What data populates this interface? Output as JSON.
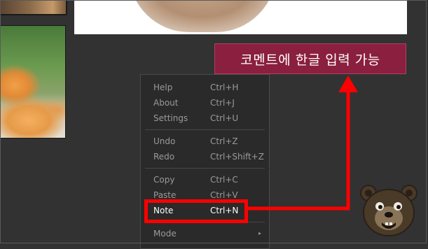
{
  "comment": {
    "text": "코멘트에 한글 입력 가능"
  },
  "context_menu": {
    "groups": [
      [
        {
          "label": "Help",
          "shortcut": "Ctrl+H"
        },
        {
          "label": "About",
          "shortcut": "Ctrl+J"
        },
        {
          "label": "Settings",
          "shortcut": "Ctrl+U"
        }
      ],
      [
        {
          "label": "Undo",
          "shortcut": "Ctrl+Z"
        },
        {
          "label": "Redo",
          "shortcut": "Ctrl+Shift+Z"
        }
      ],
      [
        {
          "label": "Copy",
          "shortcut": "Ctrl+C"
        },
        {
          "label": "Paste",
          "shortcut": "Ctrl+V"
        },
        {
          "label": "Note",
          "shortcut": "Ctrl+N"
        }
      ],
      [
        {
          "label": "Mode",
          "shortcut": ""
        }
      ]
    ],
    "submenu_arrow": "▸"
  },
  "colors": {
    "background": "#323232",
    "comment_box": "#8a1f3f",
    "highlight": "#ff0000",
    "menu_bg": "#2a2a2a",
    "menu_text": "#9a9a9a"
  },
  "icons": {
    "bear": "bear-mascot-icon"
  }
}
